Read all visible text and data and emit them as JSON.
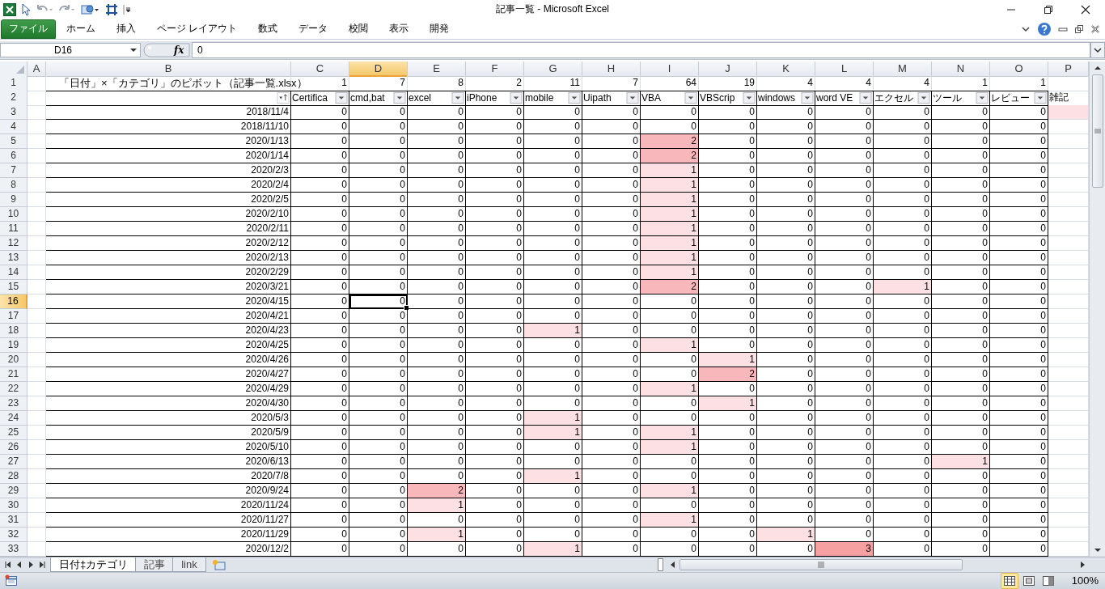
{
  "window": {
    "title": "記事一覧 - Microsoft Excel"
  },
  "ribbon_tabs": [
    {
      "label": "ファイル",
      "kind": "file"
    },
    {
      "label": "ホーム",
      "kind": "tab"
    },
    {
      "label": "挿入",
      "kind": "tab"
    },
    {
      "label": "ページ レイアウト",
      "kind": "tab"
    },
    {
      "label": "数式",
      "kind": "tab"
    },
    {
      "label": "データ",
      "kind": "tab"
    },
    {
      "label": "校閲",
      "kind": "tab"
    },
    {
      "label": "表示",
      "kind": "tab"
    },
    {
      "label": "開発",
      "kind": "tab"
    }
  ],
  "name_box": "D16",
  "function_label": "fx",
  "formula": "0",
  "columns": [
    {
      "label": "A",
      "selected": false
    },
    {
      "label": "B",
      "selected": false
    },
    {
      "label": "C",
      "selected": false
    },
    {
      "label": "D",
      "selected": true
    },
    {
      "label": "E",
      "selected": false
    },
    {
      "label": "F",
      "selected": false
    },
    {
      "label": "G",
      "selected": false
    },
    {
      "label": "H",
      "selected": false
    },
    {
      "label": "I",
      "selected": false
    },
    {
      "label": "J",
      "selected": false
    },
    {
      "label": "K",
      "selected": false
    },
    {
      "label": "L",
      "selected": false
    },
    {
      "label": "M",
      "selected": false
    },
    {
      "label": "N",
      "selected": false
    },
    {
      "label": "O",
      "selected": false
    },
    {
      "label": "P",
      "selected": false
    }
  ],
  "title_row": {
    "number": "1",
    "title": "「日付」×「カテゴリ」のピボット（記事一覧.xlsx）",
    "totals": [
      "1",
      "7",
      "8",
      "2",
      "11",
      "7",
      "64",
      "19",
      "4",
      "4",
      "4",
      "1",
      "1"
    ]
  },
  "header_row": {
    "number": "2",
    "headers": [
      {
        "label": "Certifica",
        "filter": true
      },
      {
        "label": "cmd,bat",
        "filter": true
      },
      {
        "label": "excel",
        "filter": true
      },
      {
        "label": "iPhone",
        "filter": true
      },
      {
        "label": "mobile",
        "filter": true
      },
      {
        "label": "Uipath",
        "filter": true
      },
      {
        "label": "VBA",
        "filter": true
      },
      {
        "label": "VBScrip",
        "filter": true
      },
      {
        "label": "windows",
        "filter": true
      },
      {
        "label": "word VE",
        "filter": true
      },
      {
        "label": "エクセル",
        "filter": true
      },
      {
        "label": "ツール",
        "filter": true
      },
      {
        "label": "レビュー",
        "filter": true
      },
      {
        "label": "雑記",
        "filter": false
      }
    ]
  },
  "rows": [
    {
      "number": "3",
      "date": "2018/11/4",
      "values": [
        "0",
        "0",
        "0",
        "0",
        "0",
        "0",
        "0",
        "0",
        "0",
        "0",
        "0",
        "0",
        "0"
      ],
      "p_tinted": true,
      "selected": false
    },
    {
      "number": "4",
      "date": "2018/11/10",
      "values": [
        "0",
        "0",
        "0",
        "0",
        "0",
        "0",
        "0",
        "0",
        "0",
        "0",
        "0",
        "0",
        "0"
      ],
      "p_tinted": false,
      "selected": false
    },
    {
      "number": "5",
      "date": "2020/1/13",
      "values": [
        "0",
        "0",
        "0",
        "0",
        "0",
        "0",
        "2",
        "0",
        "0",
        "0",
        "0",
        "0",
        "0"
      ],
      "p_tinted": false,
      "selected": false
    },
    {
      "number": "6",
      "date": "2020/1/14",
      "values": [
        "0",
        "0",
        "0",
        "0",
        "0",
        "0",
        "2",
        "0",
        "0",
        "0",
        "0",
        "0",
        "0"
      ],
      "p_tinted": false,
      "selected": false
    },
    {
      "number": "7",
      "date": "2020/2/3",
      "values": [
        "0",
        "0",
        "0",
        "0",
        "0",
        "0",
        "1",
        "0",
        "0",
        "0",
        "0",
        "0",
        "0"
      ],
      "p_tinted": false,
      "selected": false
    },
    {
      "number": "8",
      "date": "2020/2/4",
      "values": [
        "0",
        "0",
        "0",
        "0",
        "0",
        "0",
        "1",
        "0",
        "0",
        "0",
        "0",
        "0",
        "0"
      ],
      "p_tinted": false,
      "selected": false
    },
    {
      "number": "9",
      "date": "2020/2/5",
      "values": [
        "0",
        "0",
        "0",
        "0",
        "0",
        "0",
        "1",
        "0",
        "0",
        "0",
        "0",
        "0",
        "0"
      ],
      "p_tinted": false,
      "selected": false
    },
    {
      "number": "10",
      "date": "2020/2/10",
      "values": [
        "0",
        "0",
        "0",
        "0",
        "0",
        "0",
        "1",
        "0",
        "0",
        "0",
        "0",
        "0",
        "0"
      ],
      "p_tinted": false,
      "selected": false
    },
    {
      "number": "11",
      "date": "2020/2/11",
      "values": [
        "0",
        "0",
        "0",
        "0",
        "0",
        "0",
        "1",
        "0",
        "0",
        "0",
        "0",
        "0",
        "0"
      ],
      "p_tinted": false,
      "selected": false
    },
    {
      "number": "12",
      "date": "2020/2/12",
      "values": [
        "0",
        "0",
        "0",
        "0",
        "0",
        "0",
        "1",
        "0",
        "0",
        "0",
        "0",
        "0",
        "0"
      ],
      "p_tinted": false,
      "selected": false
    },
    {
      "number": "13",
      "date": "2020/2/13",
      "values": [
        "0",
        "0",
        "0",
        "0",
        "0",
        "0",
        "1",
        "0",
        "0",
        "0",
        "0",
        "0",
        "0"
      ],
      "p_tinted": false,
      "selected": false
    },
    {
      "number": "14",
      "date": "2020/2/29",
      "values": [
        "0",
        "0",
        "0",
        "0",
        "0",
        "0",
        "1",
        "0",
        "0",
        "0",
        "0",
        "0",
        "0"
      ],
      "p_tinted": false,
      "selected": false
    },
    {
      "number": "15",
      "date": "2020/3/21",
      "values": [
        "0",
        "0",
        "0",
        "0",
        "0",
        "0",
        "2",
        "0",
        "0",
        "0",
        "1",
        "0",
        "0"
      ],
      "p_tinted": false,
      "selected": false
    },
    {
      "number": "16",
      "date": "2020/4/15",
      "values": [
        "0",
        "0",
        "0",
        "0",
        "0",
        "0",
        "0",
        "0",
        "0",
        "0",
        "0",
        "0",
        "0"
      ],
      "p_tinted": false,
      "selected": true
    },
    {
      "number": "17",
      "date": "2020/4/21",
      "values": [
        "0",
        "0",
        "0",
        "0",
        "0",
        "0",
        "0",
        "0",
        "0",
        "0",
        "0",
        "0",
        "0"
      ],
      "p_tinted": false,
      "selected": false
    },
    {
      "number": "18",
      "date": "2020/4/23",
      "values": [
        "0",
        "0",
        "0",
        "0",
        "1",
        "0",
        "0",
        "0",
        "0",
        "0",
        "0",
        "0",
        "0"
      ],
      "p_tinted": false,
      "selected": false
    },
    {
      "number": "19",
      "date": "2020/4/25",
      "values": [
        "0",
        "0",
        "0",
        "0",
        "0",
        "0",
        "1",
        "0",
        "0",
        "0",
        "0",
        "0",
        "0"
      ],
      "p_tinted": false,
      "selected": false
    },
    {
      "number": "20",
      "date": "2020/4/26",
      "values": [
        "0",
        "0",
        "0",
        "0",
        "0",
        "0",
        "0",
        "1",
        "0",
        "0",
        "0",
        "0",
        "0"
      ],
      "p_tinted": false,
      "selected": false
    },
    {
      "number": "21",
      "date": "2020/4/27",
      "values": [
        "0",
        "0",
        "0",
        "0",
        "0",
        "0",
        "0",
        "2",
        "0",
        "0",
        "0",
        "0",
        "0"
      ],
      "p_tinted": false,
      "selected": false
    },
    {
      "number": "22",
      "date": "2020/4/29",
      "values": [
        "0",
        "0",
        "0",
        "0",
        "0",
        "0",
        "1",
        "0",
        "0",
        "0",
        "0",
        "0",
        "0"
      ],
      "p_tinted": false,
      "selected": false
    },
    {
      "number": "23",
      "date": "2020/4/30",
      "values": [
        "0",
        "0",
        "0",
        "0",
        "0",
        "0",
        "0",
        "1",
        "0",
        "0",
        "0",
        "0",
        "0"
      ],
      "p_tinted": false,
      "selected": false
    },
    {
      "number": "24",
      "date": "2020/5/3",
      "values": [
        "0",
        "0",
        "0",
        "0",
        "1",
        "0",
        "0",
        "0",
        "0",
        "0",
        "0",
        "0",
        "0"
      ],
      "p_tinted": false,
      "selected": false
    },
    {
      "number": "25",
      "date": "2020/5/9",
      "values": [
        "0",
        "0",
        "0",
        "0",
        "1",
        "0",
        "1",
        "0",
        "0",
        "0",
        "0",
        "0",
        "0"
      ],
      "p_tinted": false,
      "selected": false
    },
    {
      "number": "26",
      "date": "2020/5/10",
      "values": [
        "0",
        "0",
        "0",
        "0",
        "0",
        "0",
        "1",
        "0",
        "0",
        "0",
        "0",
        "0",
        "0"
      ],
      "p_tinted": false,
      "selected": false
    },
    {
      "number": "27",
      "date": "2020/6/13",
      "values": [
        "0",
        "0",
        "0",
        "0",
        "0",
        "0",
        "0",
        "0",
        "0",
        "0",
        "0",
        "1",
        "0"
      ],
      "p_tinted": false,
      "selected": false
    },
    {
      "number": "28",
      "date": "2020/7/8",
      "values": [
        "0",
        "0",
        "0",
        "0",
        "1",
        "0",
        "0",
        "0",
        "0",
        "0",
        "0",
        "0",
        "0"
      ],
      "p_tinted": false,
      "selected": false
    },
    {
      "number": "29",
      "date": "2020/9/24",
      "values": [
        "0",
        "0",
        "2",
        "0",
        "0",
        "0",
        "1",
        "0",
        "0",
        "0",
        "0",
        "0",
        "0"
      ],
      "p_tinted": false,
      "selected": false
    },
    {
      "number": "30",
      "date": "2020/11/24",
      "values": [
        "0",
        "0",
        "1",
        "0",
        "0",
        "0",
        "0",
        "0",
        "0",
        "0",
        "0",
        "0",
        "0"
      ],
      "p_tinted": false,
      "selected": false
    },
    {
      "number": "31",
      "date": "2020/11/27",
      "values": [
        "0",
        "0",
        "0",
        "0",
        "0",
        "0",
        "1",
        "0",
        "0",
        "0",
        "0",
        "0",
        "0"
      ],
      "p_tinted": false,
      "selected": false
    },
    {
      "number": "32",
      "date": "2020/11/29",
      "values": [
        "0",
        "0",
        "1",
        "0",
        "0",
        "0",
        "0",
        "0",
        "1",
        "0",
        "0",
        "0",
        "0"
      ],
      "p_tinted": false,
      "selected": false
    },
    {
      "number": "33",
      "date": "2020/12/2",
      "values": [
        "0",
        "0",
        "0",
        "0",
        "1",
        "0",
        "0",
        "0",
        "0",
        "3",
        "0",
        "0",
        "0"
      ],
      "p_tinted": false,
      "selected": false
    }
  ],
  "sheet_tabs": [
    {
      "label": "日付‡カテゴリ",
      "selected": true
    },
    {
      "label": "記事",
      "selected": false
    },
    {
      "label": "link",
      "selected": false
    }
  ],
  "view_buttons": [
    {
      "kind": "normal",
      "selected": true
    },
    {
      "kind": "layout",
      "selected": false
    },
    {
      "kind": "pagebreak",
      "selected": false
    }
  ],
  "zoom": "100%"
}
